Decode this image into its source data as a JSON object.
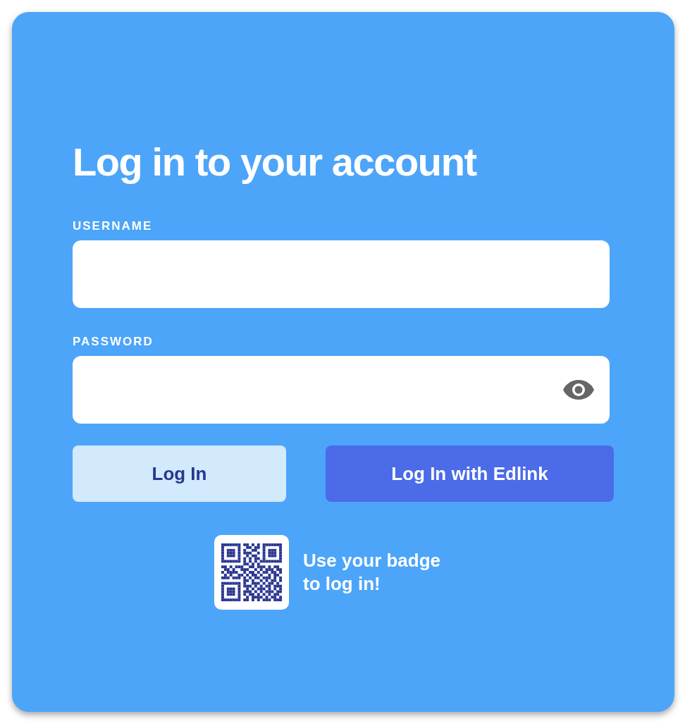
{
  "title": "Log in to your account",
  "fields": [
    {
      "label": "USERNAME",
      "kind": "text"
    },
    {
      "label": "PASSWORD",
      "kind": "password"
    }
  ],
  "buttons": [
    {
      "label": "Log In",
      "kind": "secondary"
    },
    {
      "label": "Log In with Edlink",
      "kind": "primary"
    }
  ],
  "badge_hint": {
    "lines": [
      "Use your badge",
      "to log in!"
    ]
  }
}
